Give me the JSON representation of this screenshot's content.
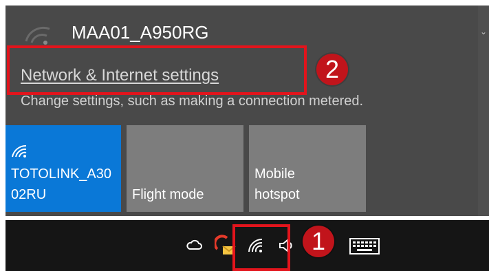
{
  "flyout": {
    "connected_network": "MAA01_A950RG",
    "settings_link": "Network & Internet settings",
    "settings_description": "Change settings, such as making a connection metered."
  },
  "quick_actions": [
    {
      "label": "TOTOLINK_A3002RU",
      "icon": "wifi-icon",
      "active": true
    },
    {
      "label": "Flight mode",
      "icon": "",
      "active": false
    },
    {
      "label": "Mobile hotspot",
      "icon": "",
      "active": false
    }
  ],
  "taskbar": {
    "icons": [
      "cloud-icon",
      "mail-notification-icon",
      "wifi-icon",
      "volume-icon",
      "keyboard-icon"
    ]
  },
  "annotations": {
    "step_1": "1",
    "step_2": "2",
    "color": "#e2141c"
  },
  "colors": {
    "flyout_bg": "#494949",
    "active_tile": "#0a78d7",
    "inactive_tile": "#7d7d7d",
    "taskbar_bg": "#151515"
  }
}
